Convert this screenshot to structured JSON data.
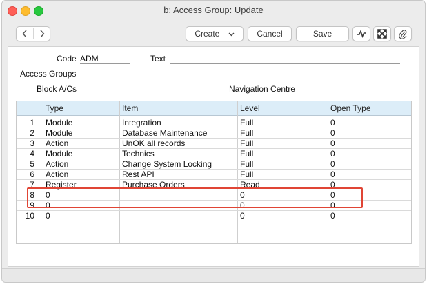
{
  "window": {
    "title": "b: Access Group: Update"
  },
  "toolbar": {
    "back_icon": "chevron-left",
    "forward_icon": "chevron-right",
    "create_label": "Create",
    "create_chevron": "⌄",
    "cancel_label": "Cancel",
    "save_label": "Save",
    "activity_icon": "activity-icon",
    "expand_icon": "expand-icon",
    "attach_icon": "paperclip-icon"
  },
  "form": {
    "code_label": "Code",
    "code_value": "ADM",
    "text_label": "Text",
    "text_value": "",
    "access_groups_label": "Access Groups",
    "access_groups_value": "",
    "block_acs_label": "Block A/Cs",
    "block_acs_value": "",
    "navigation_centre_label": "Navigation Centre",
    "navigation_centre_value": ""
  },
  "grid": {
    "columns": [
      "",
      "Type",
      "Item",
      "Level",
      "Open Type"
    ],
    "rows": [
      {
        "num": "1",
        "type": "Module",
        "item": "Integration",
        "level": "Full",
        "open": "0"
      },
      {
        "num": "2",
        "type": "Module",
        "item": "Database Maintenance",
        "level": "Full",
        "open": "0"
      },
      {
        "num": "3",
        "type": "Action",
        "item": "UnOK all records",
        "level": "Full",
        "open": "0"
      },
      {
        "num": "4",
        "type": "Module",
        "item": "Technics",
        "level": "Full",
        "open": "0"
      },
      {
        "num": "5",
        "type": "Action",
        "item": "Change System Locking",
        "level": "Full",
        "open": "0"
      },
      {
        "num": "6",
        "type": "Action",
        "item": "Rest API",
        "level": "Full",
        "open": "0"
      },
      {
        "num": "7",
        "type": "Register",
        "item": "Purchase Orders",
        "level": "Read",
        "open": "0"
      },
      {
        "num": "8",
        "type": "0",
        "item": "",
        "level": "0",
        "open": "0"
      },
      {
        "num": "9",
        "type": "0",
        "item": "",
        "level": "0",
        "open": "0"
      },
      {
        "num": "10",
        "type": "0",
        "item": "",
        "level": "0",
        "open": "0"
      }
    ]
  },
  "colors": {
    "highlight": "#e04535",
    "grid_header": "#dcedf8"
  }
}
